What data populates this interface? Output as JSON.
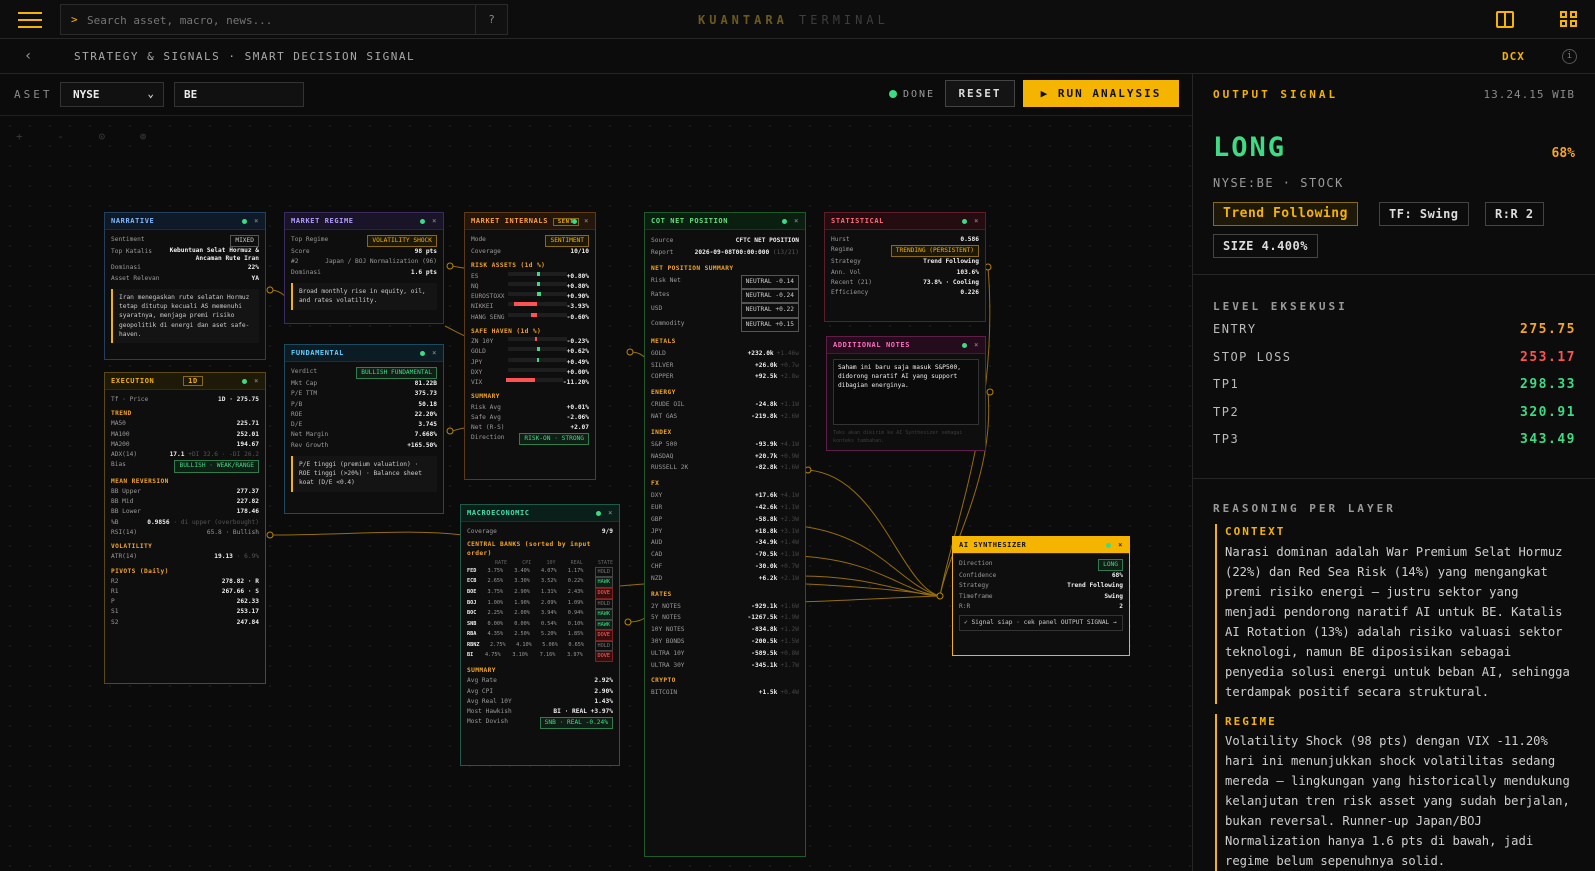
{
  "topbar": {
    "search_placeholder": "Search asset, macro, news...",
    "help": "?",
    "brand1": "KUANTARA",
    "brand2": "TERMINAL"
  },
  "subbar": {
    "back": "‹",
    "crumb": "STRATEGY & SIGNALS · SMART DECISION SIGNAL",
    "dcx": "DCX",
    "info": "i"
  },
  "toolbar": {
    "aset_label": "ASET",
    "exchange": "NYSE",
    "ticker": "BE",
    "status": "DONE",
    "reset": "RESET",
    "run": "▶ RUN ANALYSIS"
  },
  "canvas": {
    "controls": "+ - ⊙ ⊚"
  },
  "narrative": {
    "title": "NARRATIVE",
    "sentiment_l": "Sentiment",
    "sentiment_v": "MIXED",
    "katalis_l": "Top Katalis",
    "katalis_v1": "Kebuntuan Selat Hormuz &",
    "katalis_v2": "Ancaman Rute Iran",
    "dom_l": "Dominasi",
    "dom_v": "22%",
    "rel_l": "Asset Relevan",
    "rel_v": "YA",
    "note": "Iran menegaskan rute selatan Hormuz tetap ditutup kecuali AS memenuhi syaratnya, menjaga premi risiko geopolitik di energi dan aset safe-haven."
  },
  "execution": {
    "title": "EXECUTION",
    "tf": "1D",
    "tfp_l": "Tf · Price",
    "tfp_v": "1D · 275.75",
    "trend": "TREND",
    "ma50_l": "MA50",
    "ma50_v": "225.71",
    "ma100_l": "MA100",
    "ma100_v": "252.01",
    "ma200_l": "MA200",
    "ma200_v": "194.67",
    "adx_l": "ADX(14)",
    "adx_v": "17.1",
    "adx_s": "+DI 32.6 · -DI 26.2",
    "bias_l": "Bias",
    "bias_v": "BULLISH · WEAK/RANGE",
    "mr": "MEAN REVERSION",
    "bbu_l": "BB Upper",
    "bbu_v": "277.37",
    "bbm_l": "BB Mid",
    "bbm_v": "227.82",
    "bbl_l": "BB Lower",
    "bbl_v": "178.46",
    "pb_l": "%B",
    "pb_v": "0.9856",
    "pb_s": "· di upper (overbought)",
    "rsi_l": "RSI(14)",
    "rsi_v": "65.8 · Bullish",
    "vol": "VOLATILITY",
    "atr_l": "ATR(14)",
    "atr_v": "19.13",
    "atr_s": "· 6.9%",
    "piv": "PIVOTS (Daily)",
    "r2_l": "R2",
    "r2_v": "278.82 · R",
    "r1_l": "R1",
    "r1_v": "267.66 · S",
    "p_l": "P",
    "p_v": "262.33",
    "s1_l": "S1",
    "s1_v": "253.17",
    "s2_l": "S2",
    "s2_v": "247.84"
  },
  "regime": {
    "title": "MARKET REGIME",
    "top_l": "Top Regime",
    "top_v": "VOLATILITY SHOCK",
    "score_l": "Score",
    "score_v": "98 pts",
    "n2_l": "#2",
    "n2_v": "Japan / BOJ Normalization (96)",
    "dom_l": "Dominasi",
    "dom_v": "1.6 pts",
    "note": "Broad monthly rise in equity, oil, and rates volatility."
  },
  "fundamental": {
    "title": "FUNDAMENTAL",
    "verdict_l": "Verdict",
    "verdict_v": "BULLISH FUNDAMENTAL",
    "rows": [
      [
        "Mkt Cap",
        "81.22B",
        "w"
      ],
      [
        "P/E TTM",
        "375.73",
        "rd"
      ],
      [
        "P/B",
        "50.18",
        "w"
      ],
      [
        "ROE",
        "22.20%",
        "g"
      ],
      [
        "D/E",
        "3.745",
        "y"
      ],
      [
        "Net Margin",
        "7.668%",
        "w"
      ],
      [
        "Rev Growth",
        "+165.50%",
        "g"
      ]
    ],
    "note": "P/E tinggi (premium valuation) · ROE tinggi (>20%) · Balance sheet koat (D/E <0.4)"
  },
  "internals": {
    "title": "MARKET INTERNALS",
    "badge": "SENT",
    "mode_l": "Mode",
    "mode_v": "SENTIMENT",
    "cov_l": "Coverage",
    "cov_v": "10/10",
    "risk": "RISK ASSETS (1d %)",
    "risk_rows": [
      [
        "ES",
        "+0.80%",
        0.55,
        "g"
      ],
      [
        "NQ",
        "+0.80%",
        0.55,
        "g"
      ],
      [
        "EUROSTOXX",
        "+0.90%",
        0.57,
        "g"
      ],
      [
        "NIKKEI",
        "-3.93%",
        0.1,
        "rd"
      ],
      [
        "HANG SENG",
        "-0.60%",
        0.4,
        "rd"
      ]
    ],
    "safe": "SAFE HAVEN (1d %)",
    "safe_rows": [
      [
        "ZN 10Y",
        "-0.23%",
        0.46,
        "rd"
      ],
      [
        "GOLD",
        "+0.62%",
        0.54,
        "g"
      ],
      [
        "JPY",
        "+0.49%",
        0.53,
        "g"
      ],
      [
        "DXY",
        "+0.00%",
        0.5,
        "g"
      ],
      [
        "VIX",
        "-11.20%",
        0.0,
        "rd"
      ]
    ],
    "sum": "SUMMARY",
    "ra_l": "Risk Avg",
    "ra_v": "+0.01%",
    "sa_l": "Safe Avg",
    "sa_v": "-2.06%",
    "net_l": "Net (R-S)",
    "net_v": "+2.07",
    "dir_l": "Direction",
    "dir_v": "RISK-ON · STRONG"
  },
  "macro": {
    "title": "MACROECONOMIC",
    "cov_l": "Coverage",
    "cov_v": "9/9",
    "cb": "CENTRAL BANKS (sorted by input order)",
    "cols": [
      "RATE",
      "CPI",
      "10Y",
      "REAL",
      "STATE"
    ],
    "rows": [
      [
        "FED",
        "3.75%",
        "3.40%",
        "4.07%",
        "1.17%",
        "HOLD"
      ],
      [
        "ECB",
        "2.65%",
        "3.30%",
        "3.52%",
        "0.22%",
        "HAWK"
      ],
      [
        "BOE",
        "3.75%",
        "2.90%",
        "1.31%",
        "2.43%",
        "DOVE"
      ],
      [
        "BOJ",
        "1.00%",
        "1.90%",
        "2.09%",
        "1.09%",
        "HOLD"
      ],
      [
        "BOC",
        "2.25%",
        "2.00%",
        "3.94%",
        "0.94%",
        "HAWK"
      ],
      [
        "SNB",
        "0.00%",
        "0.00%",
        "0.54%",
        "0.10%",
        "HAWK"
      ],
      [
        "RBA",
        "4.35%",
        "2.50%",
        "5.20%",
        "1.85%",
        "DOVE"
      ],
      [
        "RBNZ",
        "2.75%",
        "4.10%",
        "5.06%",
        "0.65%",
        "HOLD"
      ],
      [
        "BI",
        "4.75%",
        "3.10%",
        "7.16%",
        "3.97%",
        "DOVE"
      ]
    ],
    "sum": "SUMMARY",
    "ar_l": "Avg Rate",
    "ar_v": "2.92%",
    "ac_l": "Avg CPI",
    "ac_v": "2.90%",
    "ay_l": "Avg Real 10Y",
    "ay_v": "1.43%",
    "mh_l": "Most Hawkish",
    "mh_v": "BI · REAL +3.97%",
    "md_l": "Most Dovish",
    "md_v": "SNB · REAL -0.24%"
  },
  "cot": {
    "title": "COT NET POSITION",
    "src_l": "Source",
    "src_v": "CFTC NET POSITION",
    "rep_l": "Report",
    "rep_v": "2026-09-08T00:00:000",
    "rep_s": "(13/21)",
    "nps": "NET POSITION SUMMARY",
    "summary": [
      [
        "Risk Net",
        "NEUTRAL -0.14"
      ],
      [
        "Rates",
        "NEUTRAL -0.24"
      ],
      [
        "USD",
        "NEUTRAL +0.22"
      ],
      [
        "Commodity",
        "NEUTRAL +0.15"
      ]
    ],
    "groups": [
      [
        "METALS",
        [
          [
            "GOLD",
            "+232.0k",
            "+1.46w"
          ],
          [
            "SILVER",
            "+26.0k",
            "+0.7w"
          ],
          [
            "COPPER",
            "+92.5k",
            "+2.8w"
          ]
        ]
      ],
      [
        "ENERGY",
        [
          [
            "CRUDE OIL",
            "-24.8k",
            "+1.1W"
          ],
          [
            "NAT GAS",
            "-219.8k",
            "+2.6W"
          ]
        ]
      ],
      [
        "INDEX",
        [
          [
            "S&P 500",
            "-93.9k",
            "+4.1W"
          ],
          [
            "NASDAQ",
            "+20.7k",
            "+0.9W"
          ],
          [
            "RUSSELL 2K",
            "-82.8k",
            "+1.6W"
          ]
        ]
      ],
      [
        "FX",
        [
          [
            "DXY",
            "+17.6k",
            "+4.1W"
          ],
          [
            "EUR",
            "-42.6k",
            "+1.1W"
          ],
          [
            "GBP",
            "-58.8k",
            "+2.3W"
          ],
          [
            "JPY",
            "+18.8k",
            "+3.1W"
          ],
          [
            "AUD",
            "-34.9k",
            "+1.4W"
          ],
          [
            "CAD",
            "-70.5k",
            "+1.1W"
          ],
          [
            "CHF",
            "-30.0k",
            "+0.7W"
          ],
          [
            "NZD",
            "+6.2k",
            "+2.1W"
          ]
        ]
      ],
      [
        "RATES",
        [
          [
            "2Y NOTES",
            "-929.1k",
            "+1.6W"
          ],
          [
            "5Y NOTES",
            "-1267.5k",
            "+1.9W"
          ],
          [
            "10Y NOTES",
            "-834.8k",
            "+1.2W"
          ],
          [
            "30Y BONDS",
            "-200.5k",
            "+1.5W"
          ],
          [
            "ULTRA 10Y",
            "-589.5k",
            "+0.8W"
          ],
          [
            "ULTRA 30Y",
            "-345.1k",
            "+1.7W"
          ]
        ]
      ],
      [
        "CRYPTO",
        [
          [
            "BITCOIN",
            "+1.5k",
            "+0.4W"
          ]
        ]
      ]
    ]
  },
  "statistical": {
    "title": "STATISTICAL",
    "rows": [
      [
        "Hurst",
        "0.586",
        "g"
      ],
      [
        "Regime",
        "TRENDING (PERSISTENT)",
        "tag"
      ],
      [
        "Strategy",
        "Trend Following",
        "y"
      ],
      [
        "Ann. Vol",
        "103.6%",
        "w"
      ],
      [
        "Recent (21)",
        "73.8% · Cooling",
        "g"
      ],
      [
        "Efficiency",
        "0.226",
        "w"
      ]
    ]
  },
  "notes": {
    "title": "ADDITIONAL NOTES",
    "text": "Saham ini baru saja masuk S&P500, didorong naratif AI yang support dibagian energinya.",
    "hint": "Teks akan dikirim ke AI Synthesizer sebagai konteks tambahan."
  },
  "synth": {
    "title": "AI SYNTHESIZER",
    "rows": [
      [
        "Direction",
        "LONG"
      ],
      [
        "Confidence",
        "68%"
      ],
      [
        "Strategy",
        "Trend Following"
      ],
      [
        "Timeframe",
        "Swing"
      ],
      [
        "R:R",
        "2"
      ]
    ],
    "note": "✓ Signal siap · cek panel OUTPUT SIGNAL →"
  },
  "output": {
    "title": "OUTPUT SIGNAL",
    "time": "13.24.15 WIB",
    "signal": "LONG",
    "confidence": "68%",
    "symbol": "NYSE:BE · STOCK",
    "chips": [
      "Trend Following",
      "TF: Swing",
      "R:R 2",
      "SIZE 4.400%"
    ],
    "lvl_title": "LEVEL EKSEKUSI",
    "levels": [
      [
        "ENTRY",
        "275.75",
        "#f5a623"
      ],
      [
        "STOP LOSS",
        "253.17",
        "#ff5252"
      ],
      [
        "TP1",
        "298.33",
        "#3ddc84"
      ],
      [
        "TP2",
        "320.91",
        "#3ddc84"
      ],
      [
        "TP3",
        "343.49",
        "#3ddc84"
      ]
    ],
    "rs_title": "REASONING PER LAYER",
    "rs": [
      [
        "CONTEXT",
        "Narasi dominan adalah War Premium Selat Hormuz (22%) dan Red Sea Risk (14%) yang mengangkat premi risiko energi — justru sektor yang menjadi pendorong naratif AI untuk BE. Katalis AI Rotation (13%) adalah risiko valuasi sektor teknologi, namun BE diposisikan sebagai penyedia solusi energi untuk beban AI, sehingga terdampak positif secara struktural."
      ],
      [
        "REGIME",
        "Volatility Shock (98 pts) dengan VIX -11.20% hari ini menunjukkan shock volatilitas sedang mereda — lingkungan yang historically mendukung kelanjutan tren risk asset yang sudah berjalan, bukan reversal. Runner-up Japan/BOJ Normalization hanya 1.6 pts di bawah, jadi regime belum sepenuhnya solid."
      ]
    ],
    "colors": {
      "accent": "#f5b400",
      "long": "#3ddc84",
      "short": "#ff5252"
    }
  }
}
